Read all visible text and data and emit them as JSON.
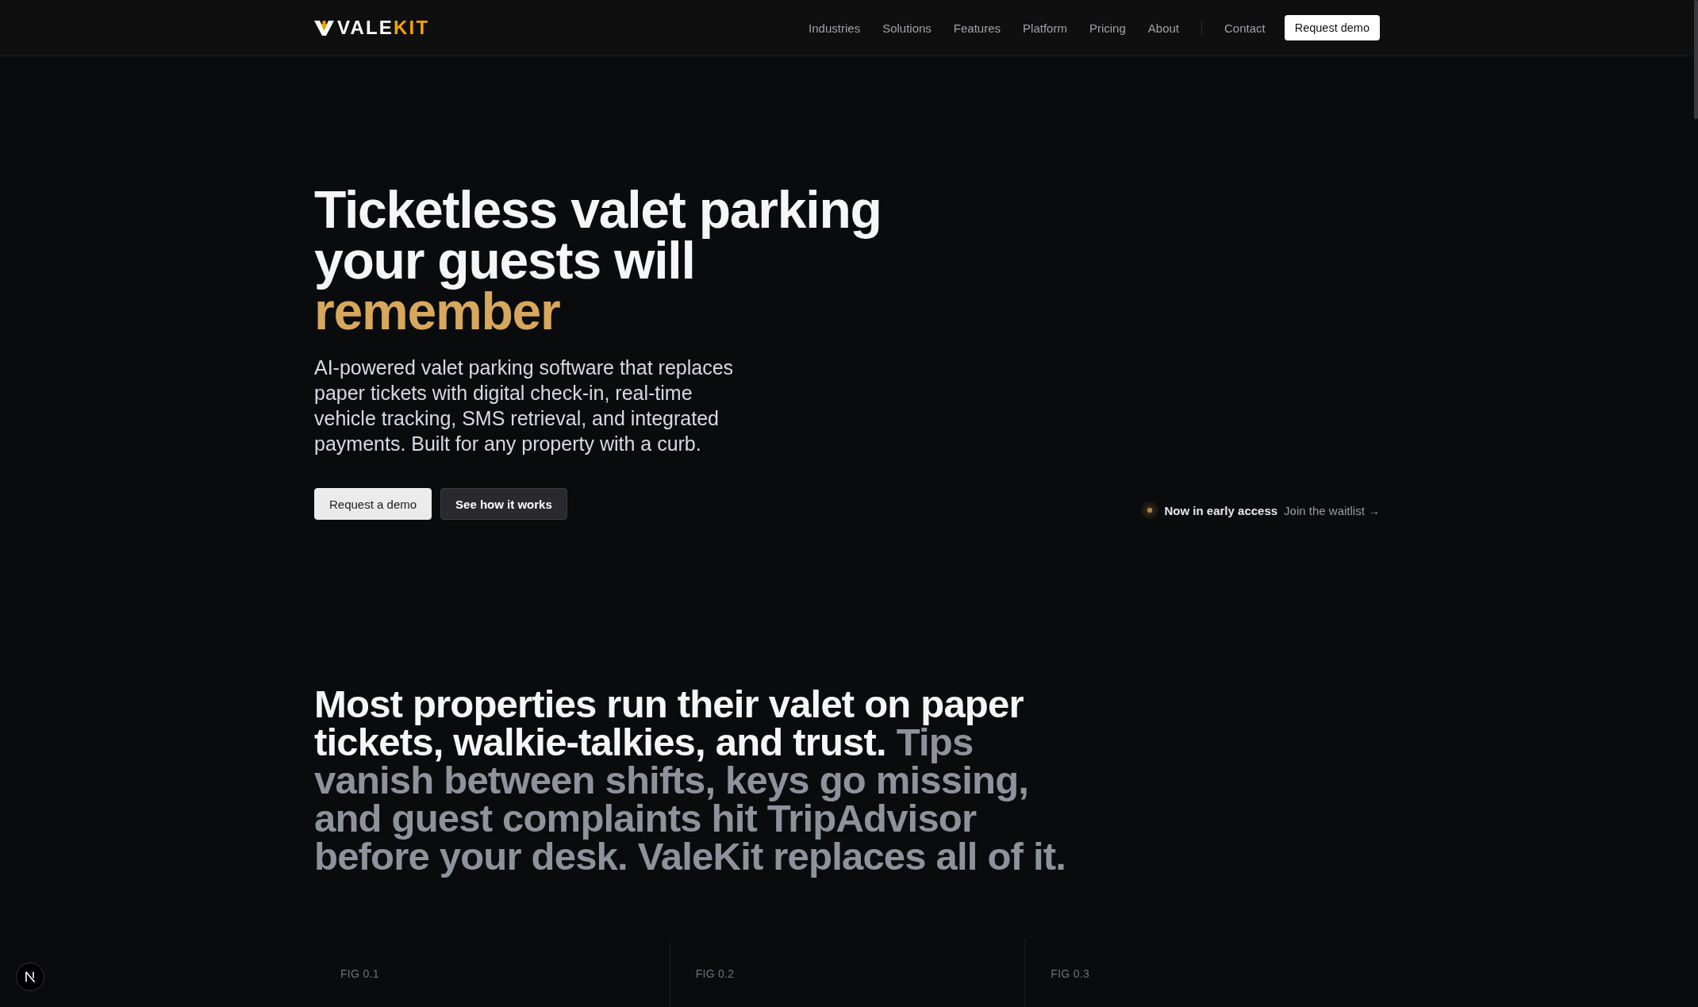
{
  "header": {
    "logo": {
      "text": "VALE",
      "accent": "KIT"
    },
    "nav": [
      {
        "label": "Industries"
      },
      {
        "label": "Solutions"
      },
      {
        "label": "Features"
      },
      {
        "label": "Platform"
      },
      {
        "label": "Pricing"
      },
      {
        "label": "About"
      }
    ],
    "secondary_nav": [
      {
        "label": "Contact"
      }
    ],
    "cta": "Request demo"
  },
  "hero": {
    "headline": "Ticketless valet parking your guests will",
    "headline_accent": "remember",
    "description": "AI-powered valet parking software that replaces paper tickets with digital check-in, real-time vehicle tracking, SMS retrieval, and integrated payments. Built for any property with a curb.",
    "buttons": [
      {
        "label": "Request a demo",
        "kind": "primary"
      },
      {
        "label": "See how it works",
        "kind": "secondary"
      }
    ],
    "status": {
      "label": "Now in early access",
      "link": "Join the waitlist →"
    }
  },
  "problem": {
    "lead": "Most properties run their valet on paper tickets, walkie-talkies, and trust.",
    "rest": "Tips vanish between shifts, keys go missing, and guest complaints hit TripAdvisor before your desk. ValeKit replaces all of it."
  },
  "figures": [
    {
      "label": "FIG 0.1"
    },
    {
      "label": "FIG 0.2"
    },
    {
      "label": "FIG 0.3"
    }
  ]
}
